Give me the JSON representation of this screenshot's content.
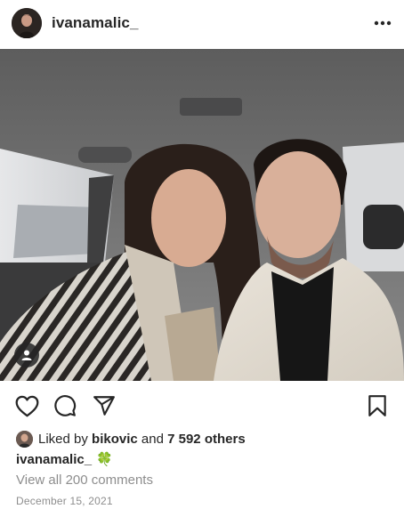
{
  "header": {
    "username": "ivanamalic_"
  },
  "photo": {
    "description_icon": "photo-icon",
    "tag_icon": "user-tag-icon"
  },
  "actions": {
    "like_icon": "heart-icon",
    "comment_icon": "comment-icon",
    "share_icon": "send-icon",
    "save_icon": "bookmark-icon"
  },
  "likes": {
    "prefix": "Liked by ",
    "user": "bikovic",
    "middle": " and ",
    "others": "7 592 others"
  },
  "caption": {
    "username": "ivanamalic_",
    "text": "🍀"
  },
  "comments_link": "View all 200 comments",
  "date": "December 15, 2021",
  "colors": {
    "text": "#262626",
    "secondary": "#8e8e8e",
    "clover": "#3a9a3a"
  }
}
